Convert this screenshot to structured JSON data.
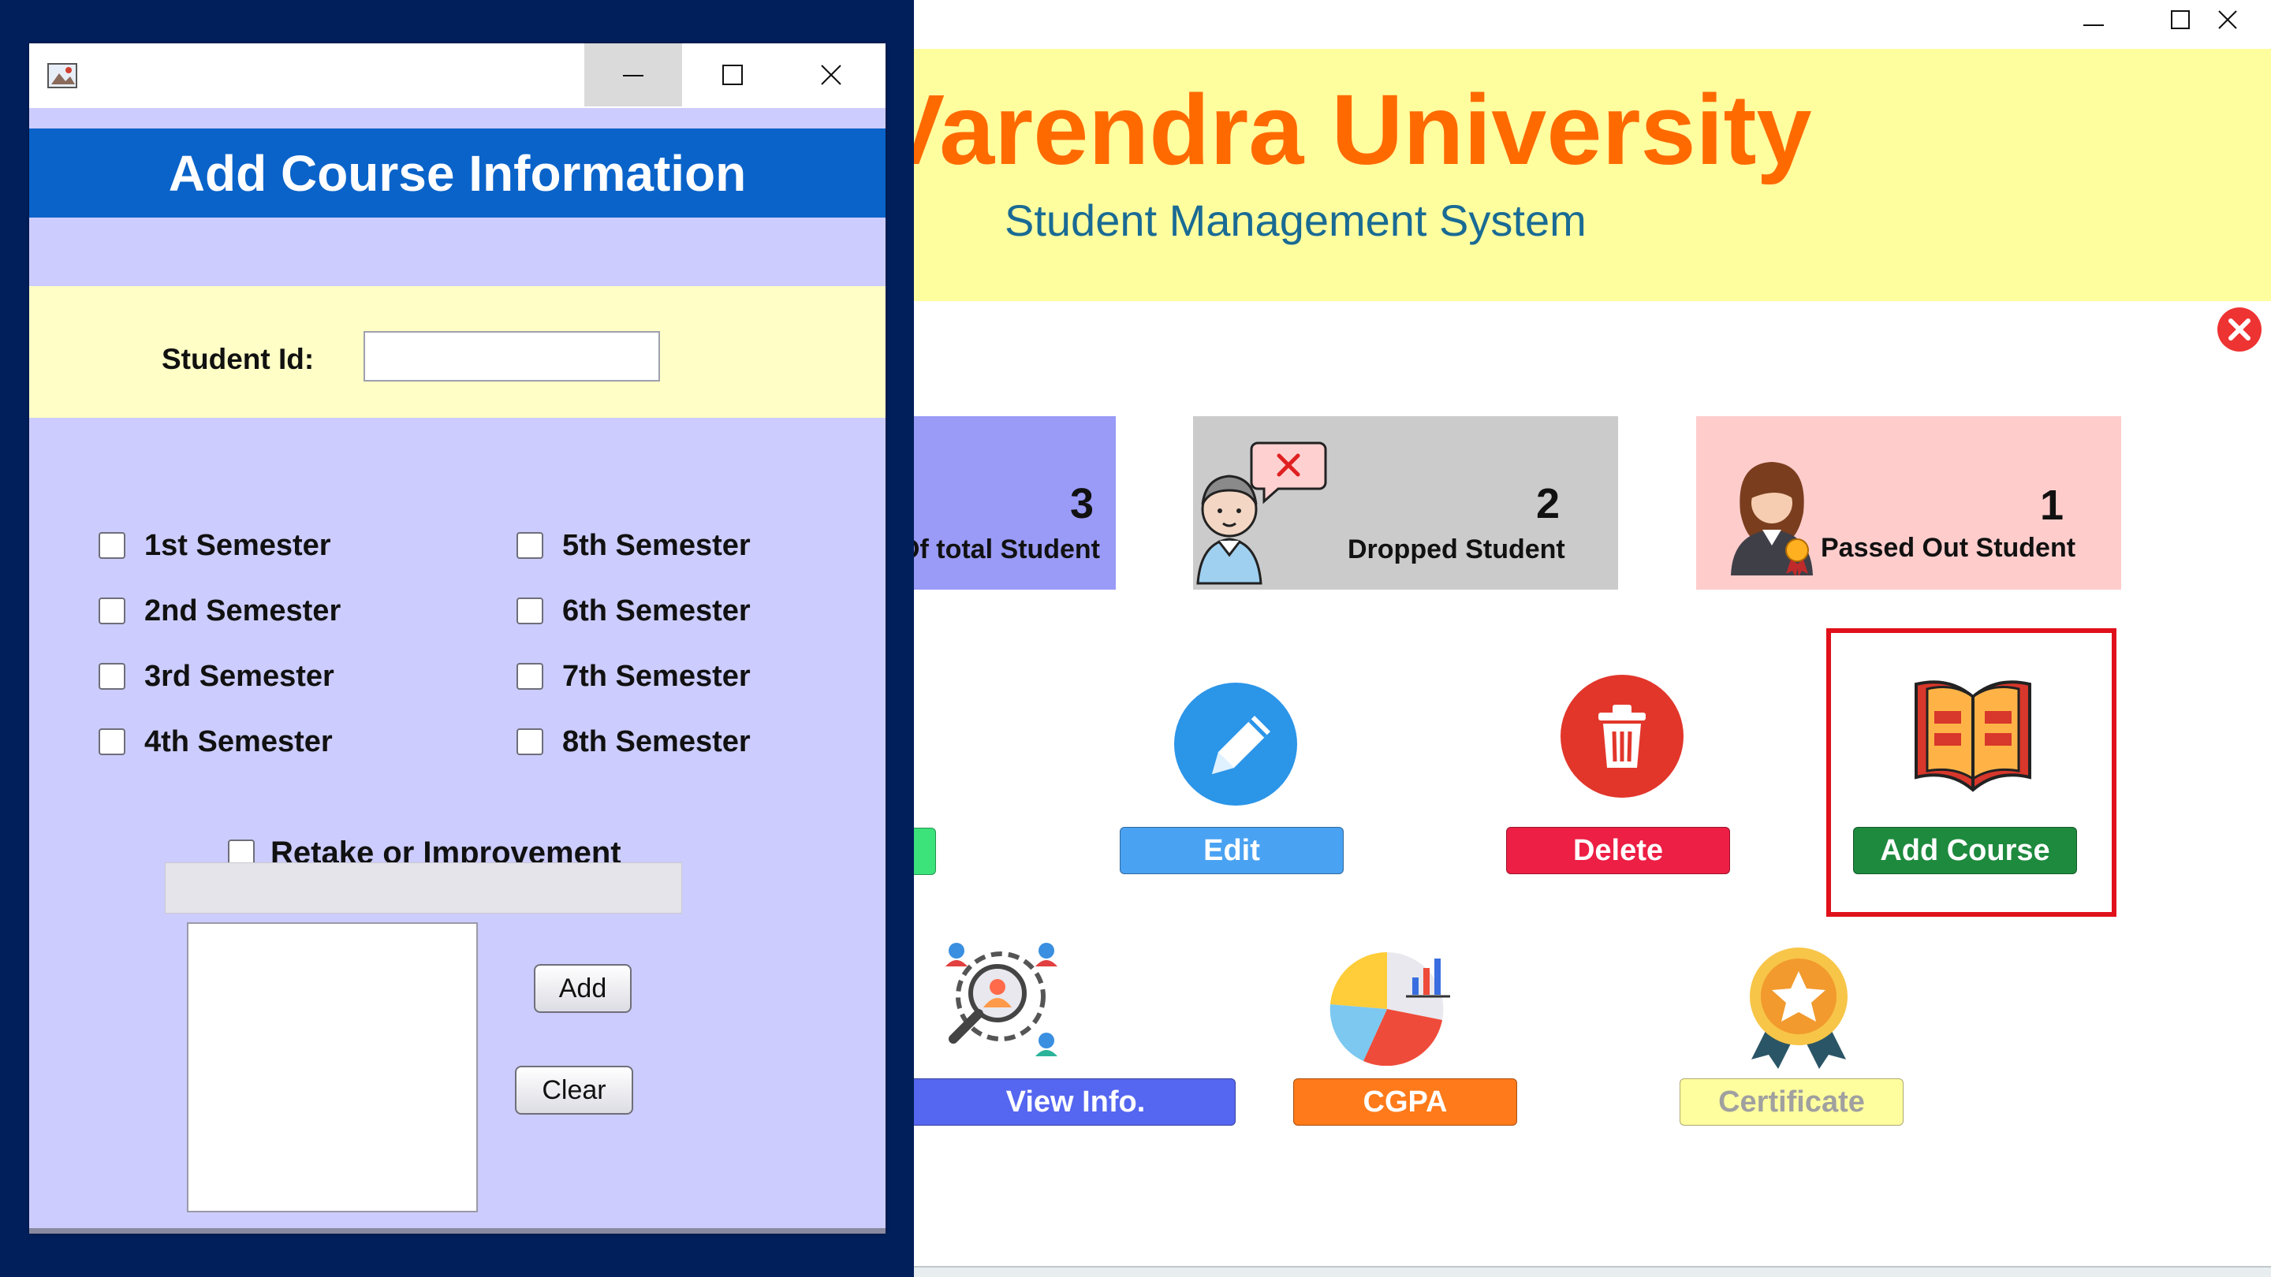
{
  "main_window": {
    "university_name": "Varendra University",
    "subtitle": "Student Management System",
    "stats": [
      {
        "value": "3",
        "label": "Of total Student",
        "color": "#9a9af7"
      },
      {
        "value": "2",
        "label": "Dropped Student",
        "color": "#cbcbcb"
      },
      {
        "value": "1",
        "label": "Passed Out Student",
        "color": "#ffcccc"
      }
    ],
    "actions": {
      "edit": "Edit",
      "delete": "Delete",
      "add_course": "Add Course",
      "view_info": "View Info.",
      "cgpa": "CGPA",
      "certificate": "Certificate"
    }
  },
  "dialog": {
    "header": "Add Course Information",
    "student_id_label": "Student Id:",
    "student_id_value": "",
    "semesters_left": [
      "1st Semester",
      "2nd Semester",
      "3rd Semester",
      "4th Semester"
    ],
    "semesters_right": [
      "5th Semester",
      "6th Semester",
      "7th Semester",
      "8th Semester"
    ],
    "retake_label": "Retake or Improvement",
    "add_button": "Add",
    "clear_button": "Clear"
  },
  "colors": {
    "header_blue": "#0a63c9",
    "dialog_bg": "#ccccfe",
    "banner_yellow": "#fefe9f",
    "title_orange": "#ff6a00",
    "highlight_red": "#e0101a"
  }
}
